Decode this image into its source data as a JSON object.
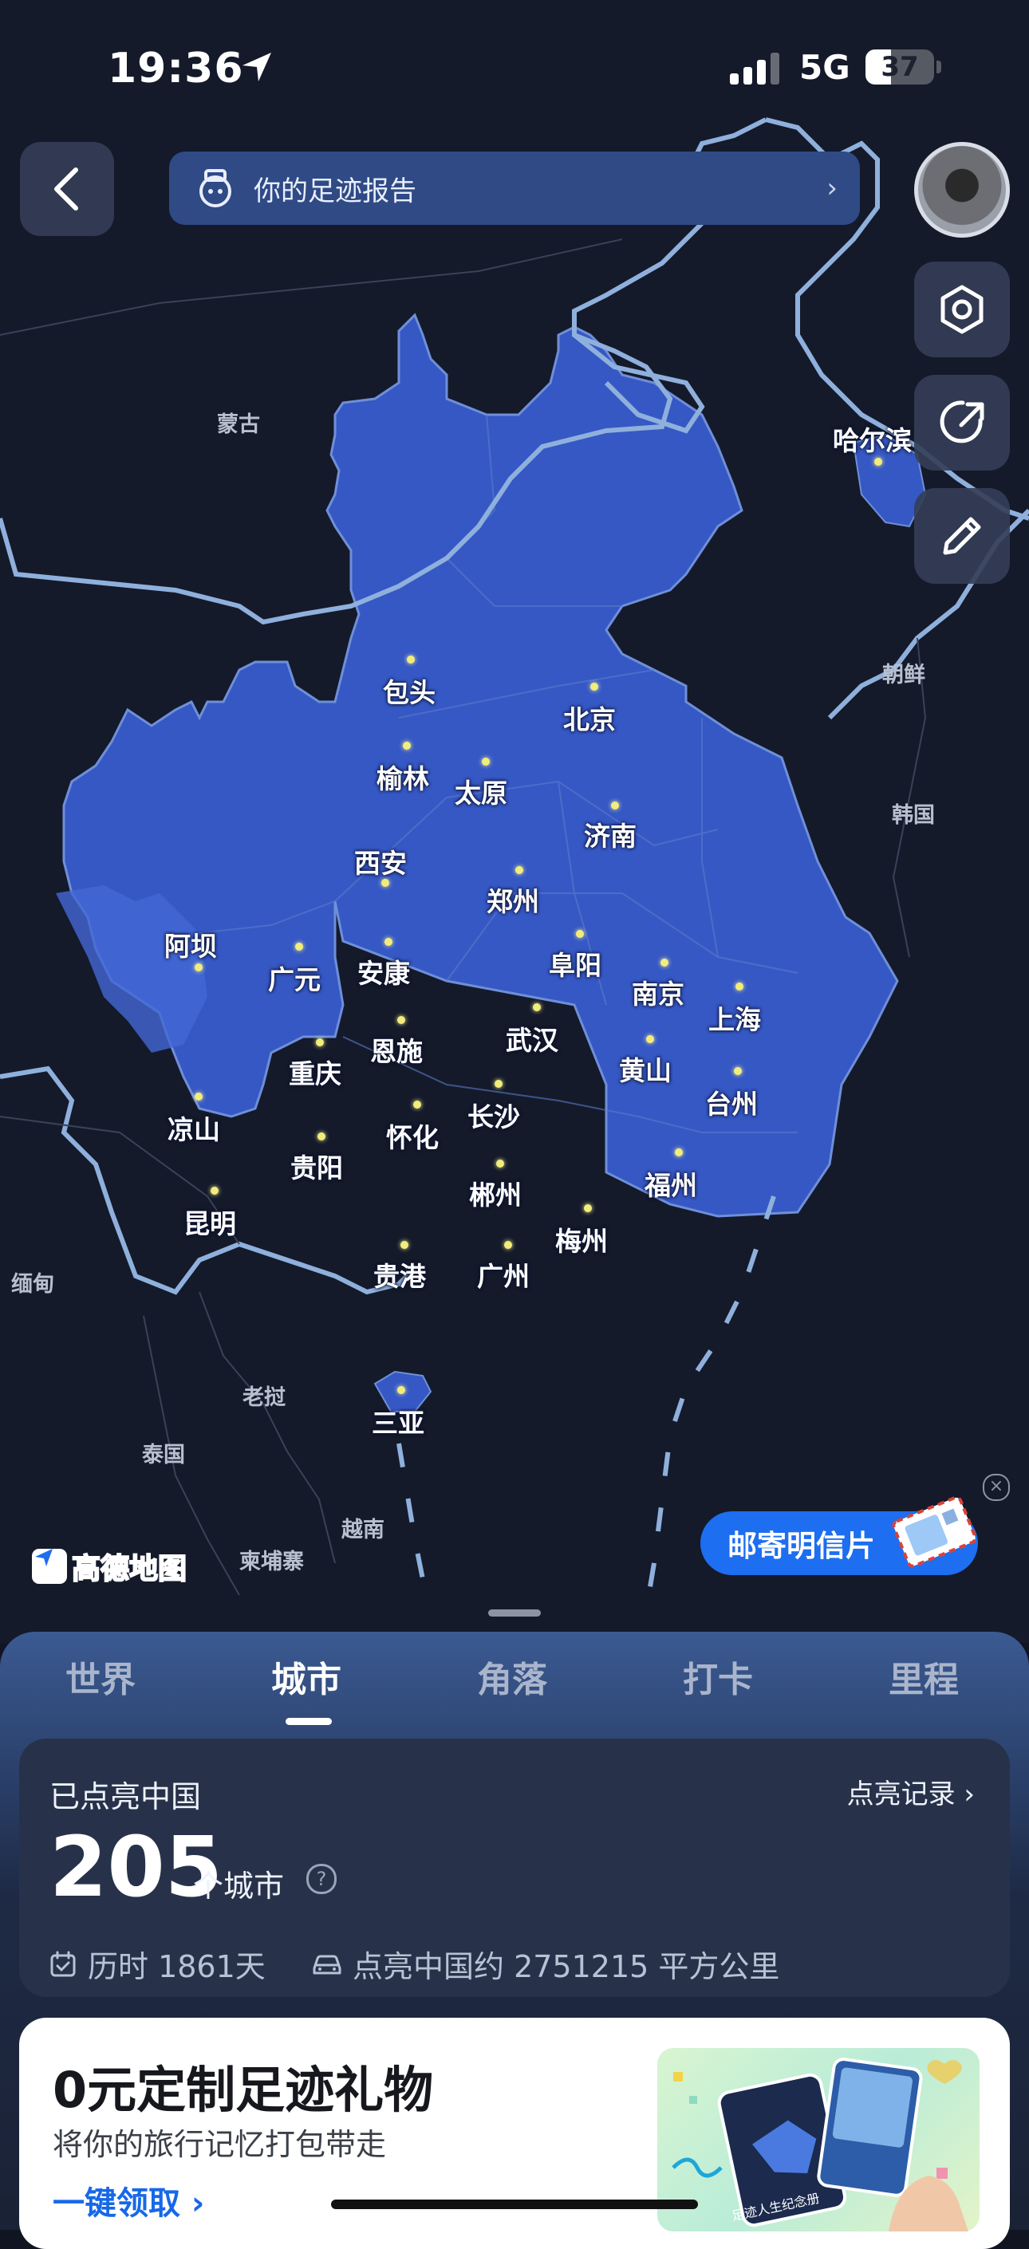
{
  "status_bar": {
    "time": "19:36",
    "network": "5G",
    "battery": "37",
    "battery_level": 0.37
  },
  "header": {
    "report_label": "你的足迹报告",
    "report_chevron": "›"
  },
  "map": {
    "cities": [
      {
        "name": "包头"
      },
      {
        "name": "北京"
      },
      {
        "name": "榆林"
      },
      {
        "name": "太原"
      },
      {
        "name": "济南"
      },
      {
        "name": "西安"
      },
      {
        "name": "郑州"
      },
      {
        "name": "阿坝"
      },
      {
        "name": "广元"
      },
      {
        "name": "安康"
      },
      {
        "name": "阜阳"
      },
      {
        "name": "南京"
      },
      {
        "name": "上海"
      },
      {
        "name": "重庆"
      },
      {
        "name": "恩施"
      },
      {
        "name": "武汉"
      },
      {
        "name": "黄山"
      },
      {
        "name": "台州"
      },
      {
        "name": "凉山"
      },
      {
        "name": "怀化"
      },
      {
        "name": "长沙"
      },
      {
        "name": "贵阳"
      },
      {
        "name": "福州"
      },
      {
        "name": "昆明"
      },
      {
        "name": "郴州"
      },
      {
        "name": "梅州"
      },
      {
        "name": "贵港"
      },
      {
        "name": "广州"
      },
      {
        "name": "三亚"
      },
      {
        "name": "哈尔滨"
      }
    ],
    "regions": [
      {
        "name": "蒙古"
      },
      {
        "name": "朝鲜"
      },
      {
        "name": "韩国"
      },
      {
        "name": "缅甸"
      },
      {
        "name": "老挝"
      },
      {
        "name": "泰国"
      },
      {
        "name": "越南"
      },
      {
        "name": "柬埔寨"
      }
    ],
    "provider": "高德地图",
    "postcard_label": "邮寄明信片",
    "close": "×",
    "colors": {
      "lit": "#3a5cc8",
      "lit_dark": "#2f4db0",
      "border": "#7f9ed6"
    }
  },
  "tabs": [
    {
      "label": "世界"
    },
    {
      "label": "城市"
    },
    {
      "label": "角落"
    },
    {
      "label": "打卡"
    },
    {
      "label": "里程"
    }
  ],
  "active_tab": "城市",
  "summary": {
    "title": "已点亮中国",
    "record_link": "点亮记录 ›",
    "count": "205",
    "unit": "个城市",
    "help": "?",
    "duration": "历时 1861天",
    "area": "点亮中国约 2751215 平方公里"
  },
  "gift": {
    "headline": "0元定制足迹礼物",
    "subtitle": "将你的旅行记忆打包带走",
    "cta": "一键领取 ›",
    "image_caption": "足迹人生纪念册"
  }
}
